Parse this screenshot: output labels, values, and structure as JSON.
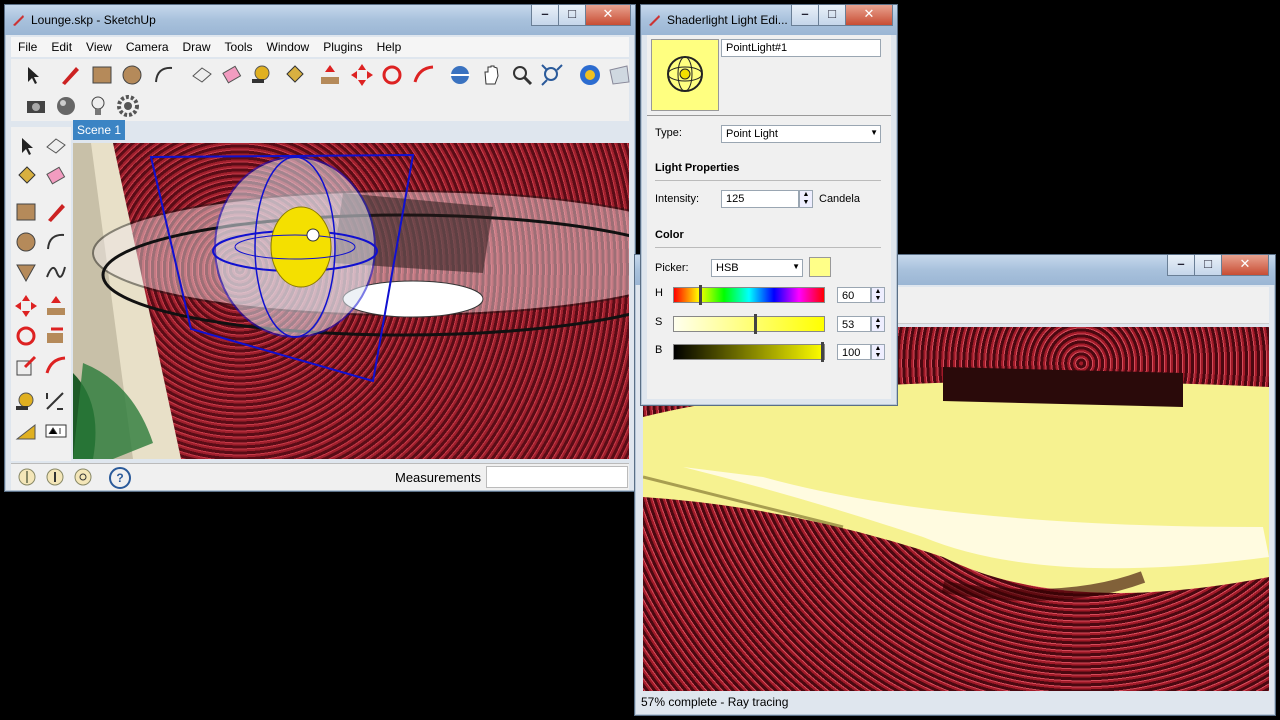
{
  "sketchup": {
    "title": "Lounge.skp - SketchUp",
    "menu": [
      "File",
      "Edit",
      "View",
      "Camera",
      "Draw",
      "Tools",
      "Window",
      "Plugins",
      "Help"
    ],
    "scene_tab": "Scene 1",
    "status": {
      "measurements_label": "Measurements",
      "help_icon": "?"
    }
  },
  "light_editor": {
    "title": "Shaderlight Light Edi...",
    "name_value": "PointLight#1",
    "type_label": "Type:",
    "type_value": "Point Light",
    "properties_heading": "Light Properties",
    "intensity_label": "Intensity:",
    "intensity_value": "125",
    "intensity_unit": "Candela",
    "color_heading": "Color",
    "picker_label": "Picker:",
    "picker_value": "HSB",
    "swatch_color": "#ffff88",
    "h_label": "H",
    "h_value": "60",
    "s_label": "S",
    "s_value": "53",
    "b_label": "B",
    "b_value": "100"
  },
  "render_window": {
    "status_text": "57% complete - Ray tracing"
  },
  "colors": {
    "accent": "#3b84c4",
    "title_gradient": "#a8c1dc",
    "viewport_red": "#9e1f2c"
  }
}
